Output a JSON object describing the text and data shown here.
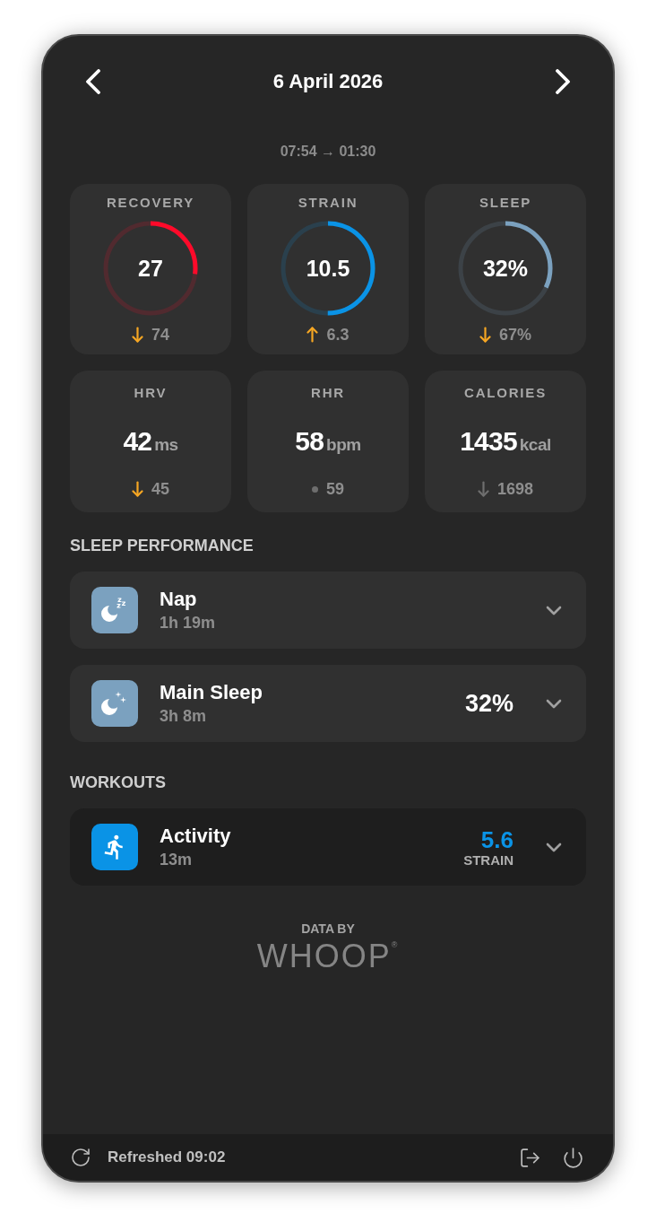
{
  "header": {
    "title": "6 April 2026"
  },
  "time_range": "07:54 → 01:30",
  "rings": [
    {
      "label": "RECOVERY",
      "value": "27",
      "level": 0.27,
      "color": "#ff0a2a",
      "delta": {
        "kind": "down",
        "value": "74",
        "color": "#f5a623"
      }
    },
    {
      "label": "STRAIN",
      "value": "10.5",
      "level": 0.5,
      "color": "#0a93e6",
      "delta": {
        "kind": "up",
        "value": "6.3",
        "color": "#f5a623"
      }
    },
    {
      "label": "SLEEP",
      "value": "32%",
      "level": 0.32,
      "color": "#7ba1bf",
      "delta": {
        "kind": "down",
        "value": "67%",
        "color": "#f5a623"
      }
    }
  ],
  "stats": [
    {
      "label": "HRV",
      "value": "42",
      "unit": "ms",
      "delta": {
        "kind": "down",
        "value": "45",
        "color": "#f5a623"
      }
    },
    {
      "label": "RHR",
      "value": "58",
      "unit": "bpm",
      "delta": {
        "kind": "dot",
        "value": "59",
        "color": "#6e6e6e"
      }
    },
    {
      "label": "CALORIES",
      "value": "1435",
      "unit": "kcal",
      "delta": {
        "kind": "down",
        "value": "1698",
        "color": "#6e6e6e"
      }
    }
  ],
  "sleep_section": {
    "title": "SLEEP PERFORMANCE",
    "items": [
      {
        "kind": "nap",
        "title": "Nap",
        "duration": "1h 19m",
        "expanded": false
      },
      {
        "kind": "main",
        "title": "Main Sleep",
        "duration": "3h 8m",
        "score": "32%",
        "expanded": false
      }
    ]
  },
  "workouts_section": {
    "title": "WORKOUTS",
    "items": [
      {
        "kind": "activity",
        "title": "Activity",
        "duration": "13m",
        "strain": "5.6",
        "strain_label": "STRAIN",
        "expanded": false
      }
    ]
  },
  "attribution": {
    "caption": "DATA BY",
    "logo": "WHOOP$^{®}$"
  },
  "status_bar": {
    "refreshed": "Refreshed 09:02"
  }
}
